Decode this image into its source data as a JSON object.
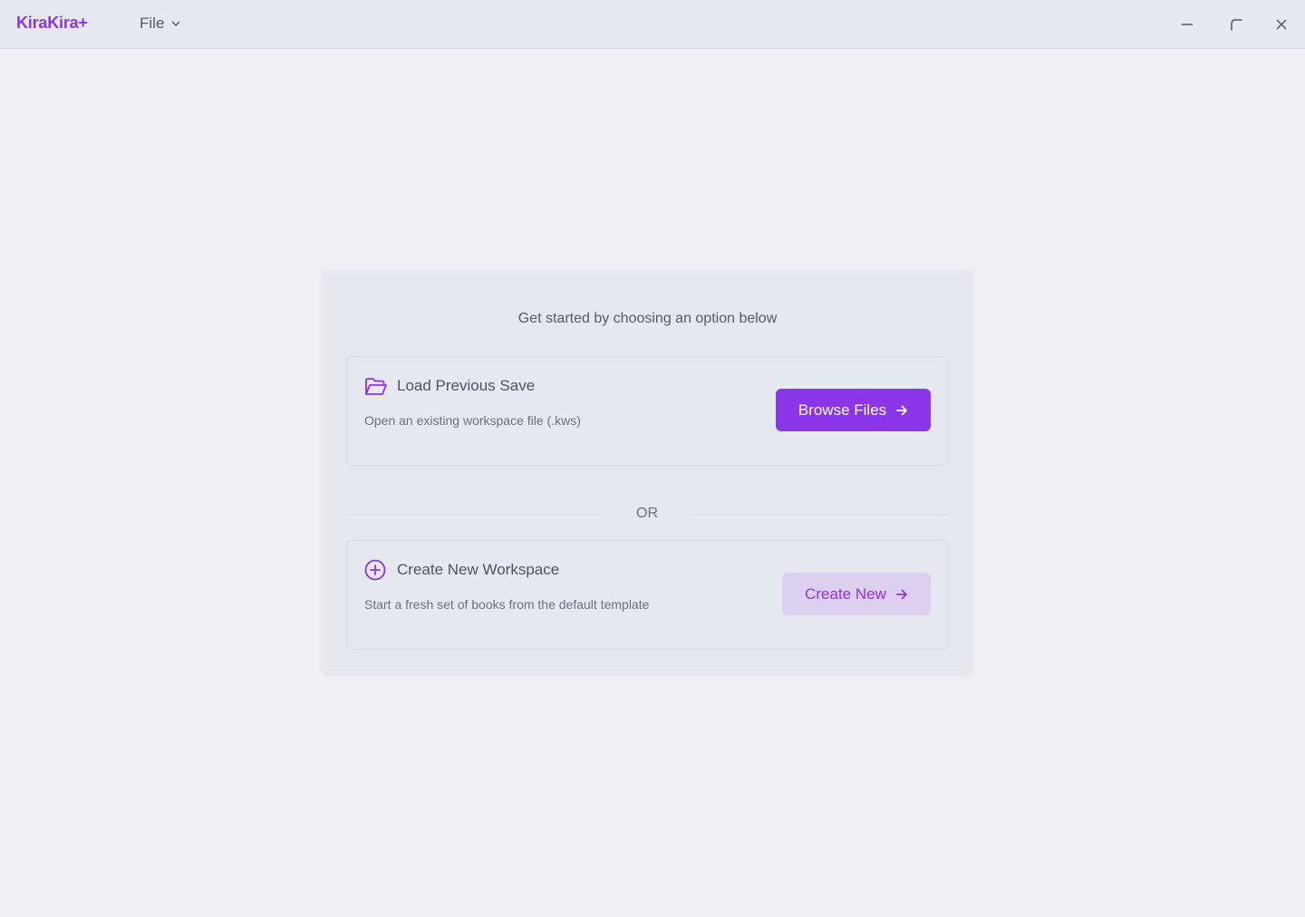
{
  "app": {
    "name": "KiraKira+",
    "accent_color": "#8b35e8"
  },
  "menubar": {
    "file_label": "File",
    "file_icon": "chevron-down-icon"
  },
  "window_controls": {
    "minimize_icon": "minimize-icon",
    "maximize_icon": "maximize-icon",
    "close_icon": "close-icon"
  },
  "welcome": {
    "heading": "Get started by choosing an option below",
    "separator": "OR",
    "options": [
      {
        "icon": "folder-open-icon",
        "title": "Load Previous Save",
        "description": "Open an existing workspace file (.kws)",
        "button_label": "Browse Files",
        "button_icon": "arrow-right-icon"
      },
      {
        "icon": "plus-circle-icon",
        "title": "Create New Workspace",
        "description": "Start a fresh set of books from the default template",
        "button_label": "Create New",
        "button_icon": "arrow-right-icon"
      }
    ]
  }
}
